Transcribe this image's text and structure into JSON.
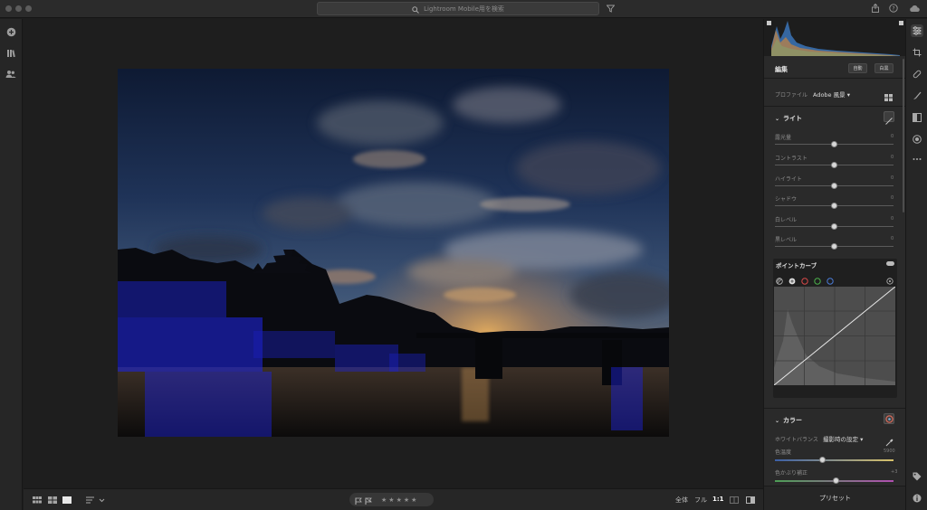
{
  "titlebar": {
    "search_placeholder": "Lightroom Mobile用を検索"
  },
  "edit_panel": {
    "title": "編集",
    "auto_label": "自動",
    "bw_label": "白黒",
    "profile_label": "プロファイル",
    "profile_value": "Adobe 風景",
    "light": {
      "title": "ライト",
      "sliders": [
        {
          "label": "露光量",
          "value": "0",
          "position": 0.5
        },
        {
          "label": "コントラスト",
          "value": "0",
          "position": 0.5
        },
        {
          "label": "ハイライト",
          "value": "0",
          "position": 0.5
        },
        {
          "label": "シャドウ",
          "value": "0",
          "position": 0.5
        },
        {
          "label": "白レベル",
          "value": "0",
          "position": 0.5
        },
        {
          "label": "黒レベル",
          "value": "0",
          "position": 0.5
        }
      ]
    },
    "point_curve": {
      "title": "ポイントカーブ",
      "channels": [
        "parametric",
        "rgb",
        "red",
        "green",
        "blue"
      ]
    },
    "color": {
      "title": "カラー",
      "wb_label": "ホワイトバランス",
      "wb_value": "撮影時の設定",
      "temp_label": "色温度",
      "temp_value": "5900",
      "temp_position": 0.4,
      "tint_label": "色かぶり補正",
      "tint_value": "+3",
      "tint_position": 0.52
    },
    "presets_label": "プリセット"
  },
  "bottombar": {
    "zoom_all": "全体",
    "zoom_fill": "フル",
    "zoom_1to1": "1:1",
    "rating": 0,
    "stars": [
      "★",
      "★",
      "★",
      "★",
      "★"
    ]
  },
  "colors": {
    "accent": "#4a6fd6",
    "panel_bg": "#2a2a2a",
    "canvas_bg": "#1e1e1e"
  }
}
